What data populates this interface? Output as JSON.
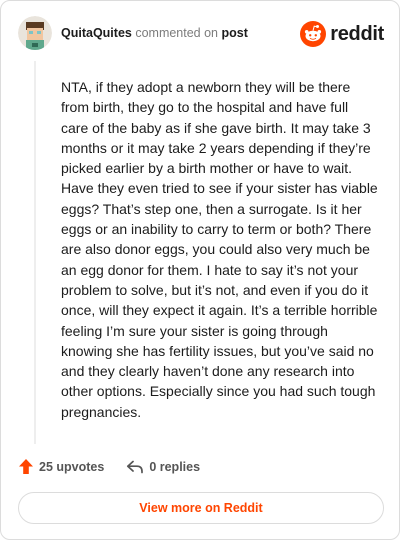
{
  "header": {
    "username": "QuitaQuites",
    "commented_on": "commented on",
    "post_link": "post"
  },
  "logo": {
    "wordmark": "reddit",
    "icon": "reddit-snoo-icon",
    "brand_color": "#ff4500"
  },
  "comment": {
    "body": "NTA, if they adopt a newborn they will be there from birth, they go to the hospital and have full care of the baby as if she gave birth. It may take 3 months or it may take 2 years depending if they’re picked earlier by a birth mother or have to wait. Have they even tried to see if your sister has viable eggs? That’s step one, then a surrogate. Is it her eggs or an inability to carry to term or both? There are also donor eggs, you could also very much be an egg donor for them. I hate to say it’s not your problem to solve, but it’s not, and even if you do it once, will they expect it again. It’s a terrible horrible feeling I’m sure your sister is going through knowing she has fertility issues, but you’ve said no and they clearly haven’t done any research into other options. Especially since you had such tough pregnancies."
  },
  "actions": {
    "upvotes": "25 upvotes",
    "replies": "0 replies"
  },
  "footer": {
    "view_more": "View more on Reddit"
  }
}
